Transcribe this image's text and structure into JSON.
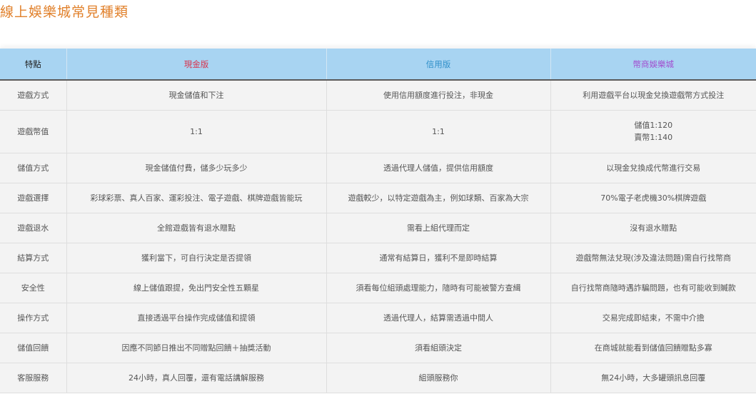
{
  "page": {
    "title": "線上娛樂城常見種類"
  },
  "table": {
    "headers": [
      {
        "label": "特點",
        "color": "#222222"
      },
      {
        "label": "現金版",
        "color": "#d9304a"
      },
      {
        "label": "信用版",
        "color": "#2e8fc9"
      },
      {
        "label": "幣商娛樂城",
        "color": "#a24ecf"
      }
    ],
    "rows": [
      {
        "feature": "遊戲方式",
        "cash": [
          "現金儲值和下注"
        ],
        "credit": [
          "使用信用額度進行投注，非現金"
        ],
        "coin": [
          "利用遊戲平台以現金兌換遊戲幣方式投注"
        ]
      },
      {
        "feature": "遊戲幣值",
        "cash": [
          "1:1"
        ],
        "credit": [
          "1:1"
        ],
        "coin": [
          "儲值1:120",
          "賣幣1:140"
        ]
      },
      {
        "feature": "儲值方式",
        "cash": [
          "現金儲值付費，儲多少玩多少"
        ],
        "credit": [
          "透過代理人儲值，提供信用額度"
        ],
        "coin": [
          "以現金兌換成代幣進行交易"
        ]
      },
      {
        "feature": "遊戲選擇",
        "cash": [
          "彩球彩票、真人百家、運彩投注、電子遊戲、棋牌遊戲皆能玩"
        ],
        "credit": [
          "遊戲較少，以特定遊戲為主，例如球類、百家為大宗"
        ],
        "coin": [
          "70%電子老虎機30%棋牌遊戲"
        ]
      },
      {
        "feature": "遊戲退水",
        "cash": [
          "全館遊戲皆有退水贈點"
        ],
        "credit": [
          "需看上組代理而定"
        ],
        "coin": [
          "沒有退水贈點"
        ]
      },
      {
        "feature": "結算方式",
        "cash": [
          "獲利當下，可自行決定是否提領"
        ],
        "credit": [
          "通常有結算日，獲利不是即時結算"
        ],
        "coin": [
          "遊戲幣無法兌現(涉及違法問題)需自行找幣商"
        ]
      },
      {
        "feature": "安全性",
        "cash": [
          "線上儲值跟提，免出門安全性五顆星"
        ],
        "credit": [
          "須看每位組頭處理能力，隨時有可能被警方查緝"
        ],
        "coin": [
          "自行找幣商隨時遇詐騙問題，也有可能收到贓款"
        ]
      },
      {
        "feature": "操作方式",
        "cash": [
          "直接透過平台操作完成儲值和提領"
        ],
        "credit": [
          "透過代理人，結算需透過中間人"
        ],
        "coin": [
          "交易完成即結束，不需中介擔"
        ]
      },
      {
        "feature": "儲值回饋",
        "cash": [
          "因應不同節日推出不同贈點回饋＋抽獎活動"
        ],
        "credit": [
          "須看組頭決定"
        ],
        "coin": [
          "在商城就能看到儲值回饋贈點多寡"
        ]
      },
      {
        "feature": "客服服務",
        "cash": [
          "24小時，真人回覆，還有電話講解服務"
        ],
        "credit": [
          "組頭服務你"
        ],
        "coin": [
          "無24小時，大多罐頭訊息回覆"
        ]
      }
    ]
  }
}
